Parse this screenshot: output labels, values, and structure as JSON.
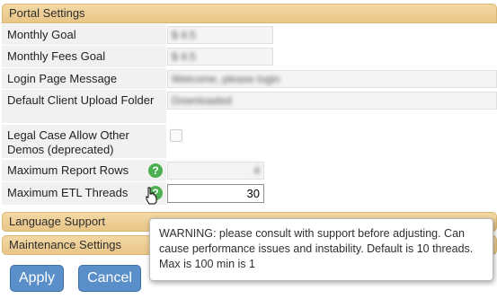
{
  "sections": {
    "portal_settings": "Portal Settings",
    "language_support": "Language Support",
    "maintenance_settings": "Maintenance Settings"
  },
  "fields": [
    {
      "label": "Monthly Goal",
      "value": "$   4.5",
      "kind": "text"
    },
    {
      "label": "Monthly Fees Goal",
      "value": "$   4.5",
      "kind": "text"
    },
    {
      "label": "Login Page Message",
      "value": "Welcome, please login",
      "kind": "text"
    },
    {
      "label": "Default Client Upload Folder",
      "value": "Downloaded",
      "kind": "text"
    },
    {
      "label": "Legal Case Allow Other Demos (deprecated)",
      "value": false,
      "kind": "checkbox"
    },
    {
      "label": "Maximum Report Rows",
      "value": "4",
      "kind": "number"
    },
    {
      "label": "Maximum ETL Threads",
      "value": "30",
      "kind": "number"
    }
  ],
  "buttons": {
    "apply": "Apply",
    "cancel": "Cancel"
  },
  "tooltip": {
    "text": "WARNING: please consult with support before adjusting. Can cause performance issues and instability. Default is 10 threads. Max is 100 min is 1"
  },
  "icons": {
    "help": "question-circle-icon",
    "cursor": "hand-pointer-icon"
  },
  "colors": {
    "section_header": "#edcc91",
    "button": "#5b8fc9",
    "help_icon": "#4caf50"
  }
}
